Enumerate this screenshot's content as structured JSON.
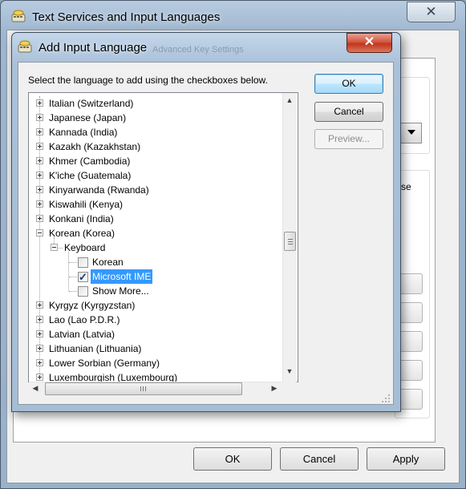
{
  "back_window": {
    "title": "Text Services and Input Languages",
    "close_glyph": "✕",
    "side_text": "se",
    "buttons": {
      "ok": "OK",
      "cancel": "Cancel",
      "apply": "Apply"
    }
  },
  "dialog": {
    "title": "Add Input Language",
    "ghost_title": "Advanced Key Settings",
    "close_glyph": "✕",
    "instruction": "Select the language to add using the checkboxes below.",
    "buttons": {
      "ok": "OK",
      "cancel": "Cancel",
      "preview": "Preview..."
    },
    "tree": {
      "languages_before": [
        "Italian (Switzerland)",
        "Japanese (Japan)",
        "Kannada (India)",
        "Kazakh (Kazakhstan)",
        "Khmer (Cambodia)",
        "K'iche (Guatemala)",
        "Kinyarwanda (Rwanda)",
        "Kiswahili (Kenya)",
        "Konkani (India)"
      ],
      "expanded_language": "Korean (Korea)",
      "keyboard_label": "Keyboard",
      "keyboards": [
        {
          "label": "Korean",
          "checked": false
        },
        {
          "label": "Microsoft IME",
          "checked": true
        },
        {
          "label": "Show More...",
          "checked": false
        }
      ],
      "languages_after": [
        "Kyrgyz (Kyrgyzstan)",
        "Lao (Lao P.D.R.)",
        "Latvian (Latvia)",
        "Lithuanian (Lithuania)",
        "Lower Sorbian (Germany)",
        "Luxembourgish (Luxembourg)"
      ]
    }
  },
  "colors": {
    "selection": "#3399ff",
    "close_red": "#c2351d",
    "default_button_border": "#3c7fb1"
  }
}
